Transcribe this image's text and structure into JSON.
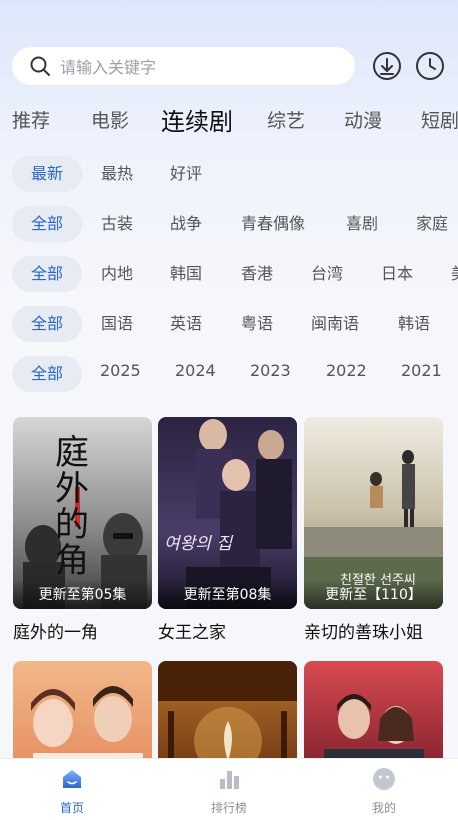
{
  "search": {
    "placeholder": "请输入关键字"
  },
  "categories": [
    {
      "label": "推荐"
    },
    {
      "label": "电影"
    },
    {
      "label": "连续剧"
    },
    {
      "label": "综艺"
    },
    {
      "label": "动漫"
    },
    {
      "label": "短剧"
    }
  ],
  "active_category": "连续剧",
  "filters": {
    "sort": [
      "最新",
      "最热",
      "好评"
    ],
    "genre": [
      "全部",
      "古装",
      "战争",
      "青春偶像",
      "喜剧",
      "家庭",
      "犯"
    ],
    "region": [
      "全部",
      "内地",
      "韩国",
      "香港",
      "台湾",
      "日本",
      "美"
    ],
    "language": [
      "全部",
      "国语",
      "英语",
      "粤语",
      "闽南语",
      "韩语"
    ],
    "year": [
      "全部",
      "2025",
      "2024",
      "2023",
      "2022",
      "2021"
    ]
  },
  "cards": [
    {
      "title": "庭外的一角",
      "status": "更新至第05集",
      "poster_text": "庭外的角"
    },
    {
      "title": "女王之家",
      "status": "更新至第08集",
      "poster_text": "여왕의 집"
    },
    {
      "title": "亲切的善珠小姐",
      "status": "更新至【110】",
      "poster_text": "친절한 선주씨"
    }
  ],
  "bottom_nav": [
    {
      "label": "首页",
      "icon": "home-icon",
      "active": true
    },
    {
      "label": "排行榜",
      "icon": "rank-icon",
      "active": false
    },
    {
      "label": "我的",
      "icon": "profile-icon",
      "active": false
    }
  ],
  "colors": {
    "accent": "#2b67c8",
    "chip_bg": "#e6ebf4"
  }
}
